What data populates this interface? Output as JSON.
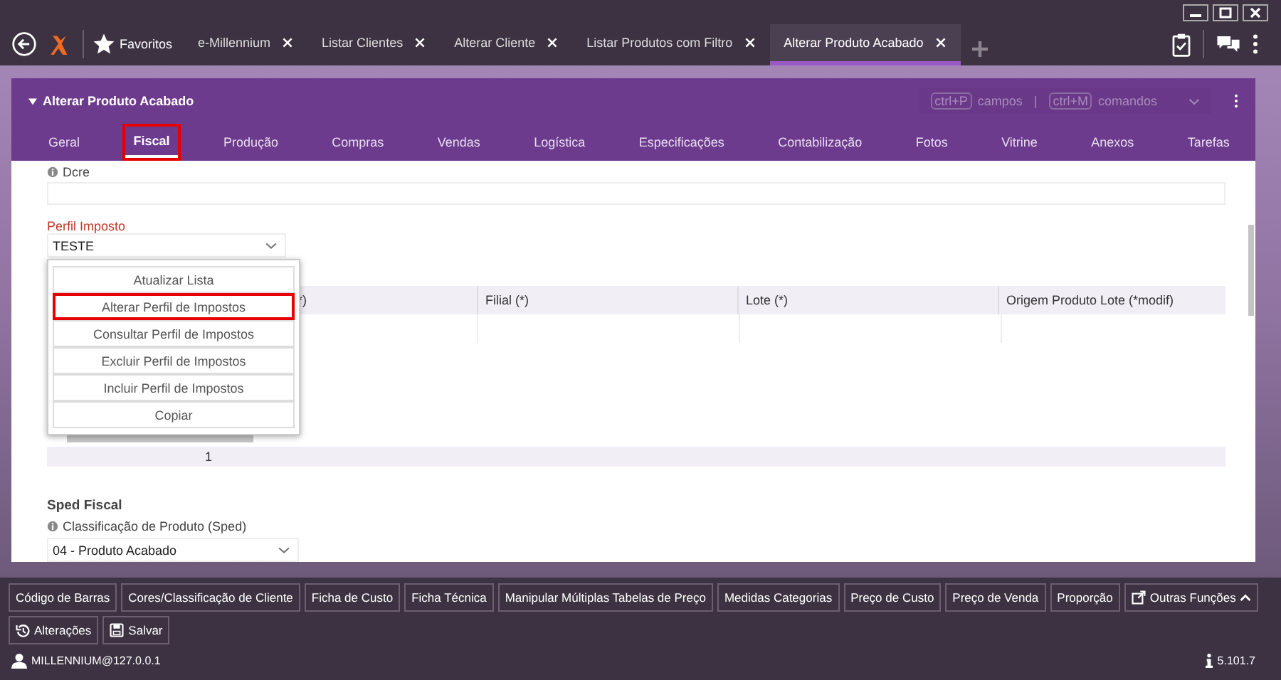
{
  "app_tabs": {
    "favorites": "Favoritos",
    "tabs": [
      {
        "label": "e-Millennium",
        "selected": false
      },
      {
        "label": "Listar Clientes",
        "selected": false
      },
      {
        "label": "Alterar Cliente",
        "selected": false
      },
      {
        "label": "Listar Produtos com Filtro",
        "selected": false
      },
      {
        "label": "Alterar Produto Acabado",
        "selected": true
      }
    ]
  },
  "form": {
    "title": "Alterar Produto Acabado",
    "shortcuts": [
      {
        "key": "ctrl+P",
        "label": "campos"
      },
      {
        "key": "ctrl+M",
        "label": "comandos"
      }
    ],
    "shortcut_separator": "|",
    "tabs": [
      {
        "label": "Geral",
        "selected": false
      },
      {
        "label": "Fiscal",
        "selected": true
      },
      {
        "label": "Produção",
        "selected": false
      },
      {
        "label": "Compras",
        "selected": false
      },
      {
        "label": "Vendas",
        "selected": false
      },
      {
        "label": "Logística",
        "selected": false
      },
      {
        "label": "Especificações",
        "selected": false
      },
      {
        "label": "Contabilização",
        "selected": false
      },
      {
        "label": "Fotos",
        "selected": false
      },
      {
        "label": "Vitrine",
        "selected": false
      },
      {
        "label": "Anexos",
        "selected": false
      },
      {
        "label": "Tarefas",
        "selected": false
      }
    ],
    "dcre": {
      "label": "Dcre"
    },
    "perfil_imposto": {
      "label": "Perfil Imposto",
      "value": "TESTE",
      "menu": [
        {
          "label": "Atualizar Lista",
          "selected": false
        },
        {
          "label": "Alterar Perfil de Impostos",
          "selected": true
        },
        {
          "label": "Consultar Perfil de Impostos",
          "selected": false
        },
        {
          "label": "Excluir Perfil de Impostos",
          "selected": false
        },
        {
          "label": "Incluir Perfil de Impostos",
          "selected": false
        },
        {
          "label": "Copiar",
          "selected": false
        }
      ]
    },
    "table": {
      "columns": [
        "*)",
        "Filial (*)",
        "Lote (*)",
        "Origem Produto Lote (*modif)"
      ],
      "page": "1"
    },
    "sped": {
      "title": "Sped Fiscal",
      "label": "Classificação de Produto (Sped)",
      "value": "04 - Produto Acabado"
    }
  },
  "actions": [
    {
      "label": "Código de Barras",
      "kind": "plain"
    },
    {
      "label": "Cores/Classificação de Cliente",
      "kind": "plain"
    },
    {
      "label": "Ficha de Custo",
      "kind": "plain"
    },
    {
      "label": "Ficha Técnica",
      "kind": "plain"
    },
    {
      "label": "Manipular Múltiplas Tabelas de Preço",
      "kind": "plain"
    },
    {
      "label": "Medidas Categorias",
      "kind": "plain"
    },
    {
      "label": "Preço de Custo",
      "kind": "plain"
    },
    {
      "label": "Preço de Venda",
      "kind": "plain"
    },
    {
      "label": "Proporção",
      "kind": "plain"
    },
    {
      "label": "Outras Funções",
      "kind": "more"
    }
  ],
  "commands": [
    {
      "label": "Alterações",
      "kind": "history"
    },
    {
      "label": "Salvar",
      "kind": "save"
    }
  ],
  "status_bar": {
    "user": "MILLENNIUM@127.0.0.1",
    "version": "5.101.7"
  }
}
